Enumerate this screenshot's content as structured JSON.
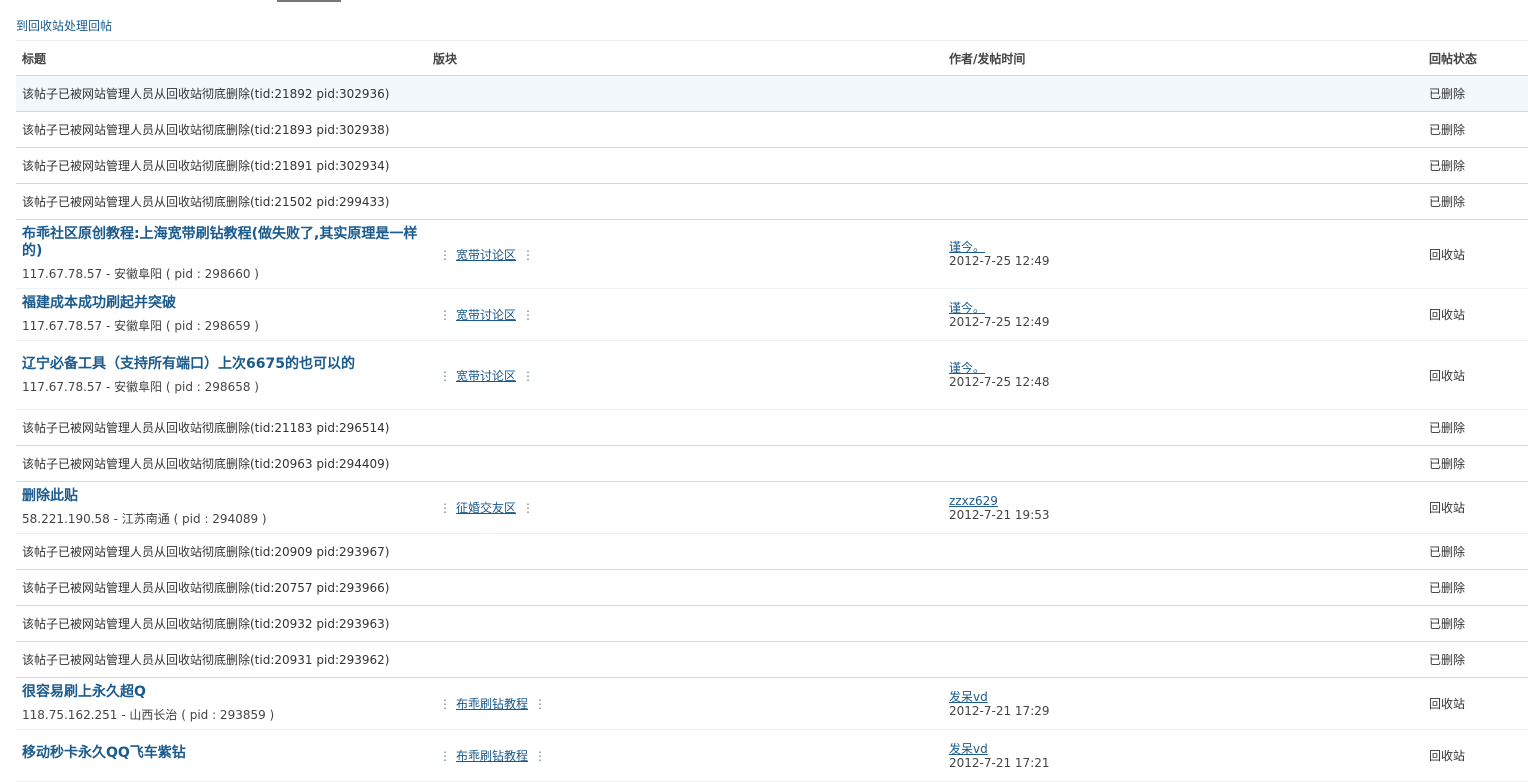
{
  "top_link": "到回收站处理回帖",
  "table": {
    "headers": {
      "title": "标题",
      "forum": "版块",
      "author_time": "作者/发帖时间",
      "status": "回帖状态"
    }
  },
  "rows": [
    {
      "type": "deleted",
      "text": "该帖子已被网站管理人员从回收站彻底删除(tid:21892 pid:302936)",
      "status": "已删除"
    },
    {
      "type": "deleted",
      "text": "该帖子已被网站管理人员从回收站彻底删除(tid:21893 pid:302938)",
      "status": "已删除"
    },
    {
      "type": "deleted",
      "text": "该帖子已被网站管理人员从回收站彻底删除(tid:21891 pid:302934)",
      "status": "已删除"
    },
    {
      "type": "deleted",
      "text": "该帖子已被网站管理人员从回收站彻底删除(tid:21502 pid:299433)",
      "status": "已删除"
    },
    {
      "type": "post",
      "title": "布乖社区原创教程:上海宽带刷钻教程(做失败了,其实原理是一样的)",
      "ip": "117.67.78.57 - 安徽阜阳 ( pid : 298660 )",
      "forum": "宽带讨论区",
      "author": "谨今。",
      "time": "2012-7-25 12:49",
      "status": "回收站"
    },
    {
      "type": "post",
      "title": "福建成本成功刷起并突破",
      "ip": "117.67.78.57 - 安徽阜阳 ( pid : 298659 )",
      "forum": "宽带讨论区",
      "author": "谨今。",
      "time": "2012-7-25 12:49",
      "status": "回收站"
    },
    {
      "type": "post",
      "title": "辽宁必备工具（支持所有端口）上次6675的也可以的",
      "ip": "117.67.78.57 - 安徽阜阳 ( pid : 298658 )",
      "forum": "宽带讨论区",
      "author": "谨今。",
      "time": "2012-7-25 12:48",
      "status": "回收站"
    },
    {
      "type": "deleted",
      "text": "该帖子已被网站管理人员从回收站彻底删除(tid:21183 pid:296514)",
      "status": "已删除"
    },
    {
      "type": "deleted",
      "text": "该帖子已被网站管理人员从回收站彻底删除(tid:20963 pid:294409)",
      "status": "已删除"
    },
    {
      "type": "post",
      "title": "删除此贴",
      "ip": "58.221.190.58 - 江苏南通 ( pid : 294089 )",
      "forum": "征婚交友区",
      "author": "zzxz629",
      "time": "2012-7-21 19:53",
      "status": "回收站"
    },
    {
      "type": "deleted",
      "text": "该帖子已被网站管理人员从回收站彻底删除(tid:20909 pid:293967)",
      "status": "已删除"
    },
    {
      "type": "deleted",
      "text": "该帖子已被网站管理人员从回收站彻底删除(tid:20757 pid:293966)",
      "status": "已删除"
    },
    {
      "type": "deleted",
      "text": "该帖子已被网站管理人员从回收站彻底删除(tid:20932 pid:293963)",
      "status": "已删除"
    },
    {
      "type": "deleted",
      "text": "该帖子已被网站管理人员从回收站彻底删除(tid:20931 pid:293962)",
      "status": "已删除"
    },
    {
      "type": "post",
      "title": "很容易刷上永久超Q",
      "ip": "118.75.162.251 - 山西长治 ( pid : 293859 )",
      "forum": "布乖刷钻教程",
      "author": "发呆vd",
      "time": "2012-7-21 17:29",
      "status": "回收站"
    },
    {
      "type": "post",
      "title": "移动秒卡永久QQ飞车紫钻",
      "ip": "",
      "forum": "布乖刷钻教程",
      "author": "发呆vd",
      "time": "2012-7-21 17:21",
      "status": "回收站"
    }
  ]
}
